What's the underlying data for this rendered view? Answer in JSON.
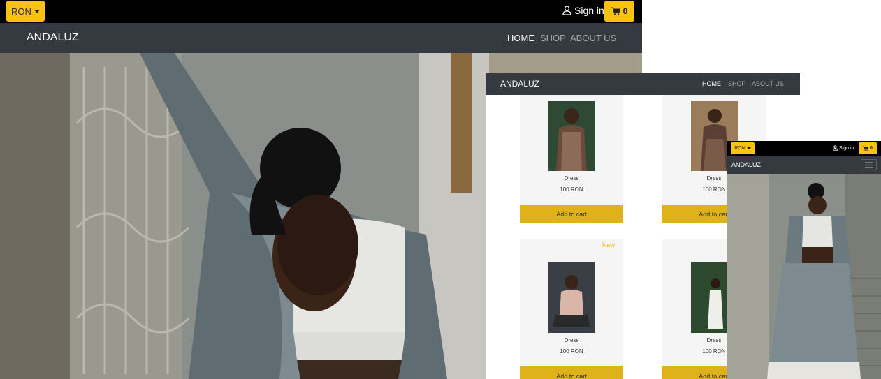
{
  "desktop": {
    "currency": "RON",
    "signin": "Sign in",
    "cart_count": "0",
    "brand": "ANDALUZ",
    "nav": {
      "home": "HOME",
      "shop": "SHOP",
      "about": "ABOUT US"
    }
  },
  "tablet": {
    "brand": "ANDALUZ",
    "nav": {
      "home": "HOME",
      "shop": "SHOP",
      "about": "ABOUT US"
    },
    "products": [
      {
        "name": "Dress",
        "price": "100 RON",
        "button": "Add to cart",
        "tag": ""
      },
      {
        "name": "Dress",
        "price": "100 RON",
        "button": "Add to cart",
        "tag": ""
      },
      {
        "name": "Dress",
        "price": "100 RON",
        "button": "Add to cart",
        "tag": "New"
      },
      {
        "name": "Dress",
        "price": "100 RON",
        "button": "Add to cart",
        "tag": ""
      }
    ]
  },
  "mobile": {
    "currency": "RON",
    "signin": "Sign in",
    "cart_count": "0",
    "brand": "ANDALUZ"
  },
  "colors": {
    "accent": "#f8c20f",
    "navbar": "#343a40",
    "topbar": "#000000",
    "add_button": "#e0b21a",
    "new_tag": "#f5b700"
  },
  "icons": [
    "caret-down-icon",
    "user-icon",
    "cart-icon",
    "hamburger-icon"
  ]
}
